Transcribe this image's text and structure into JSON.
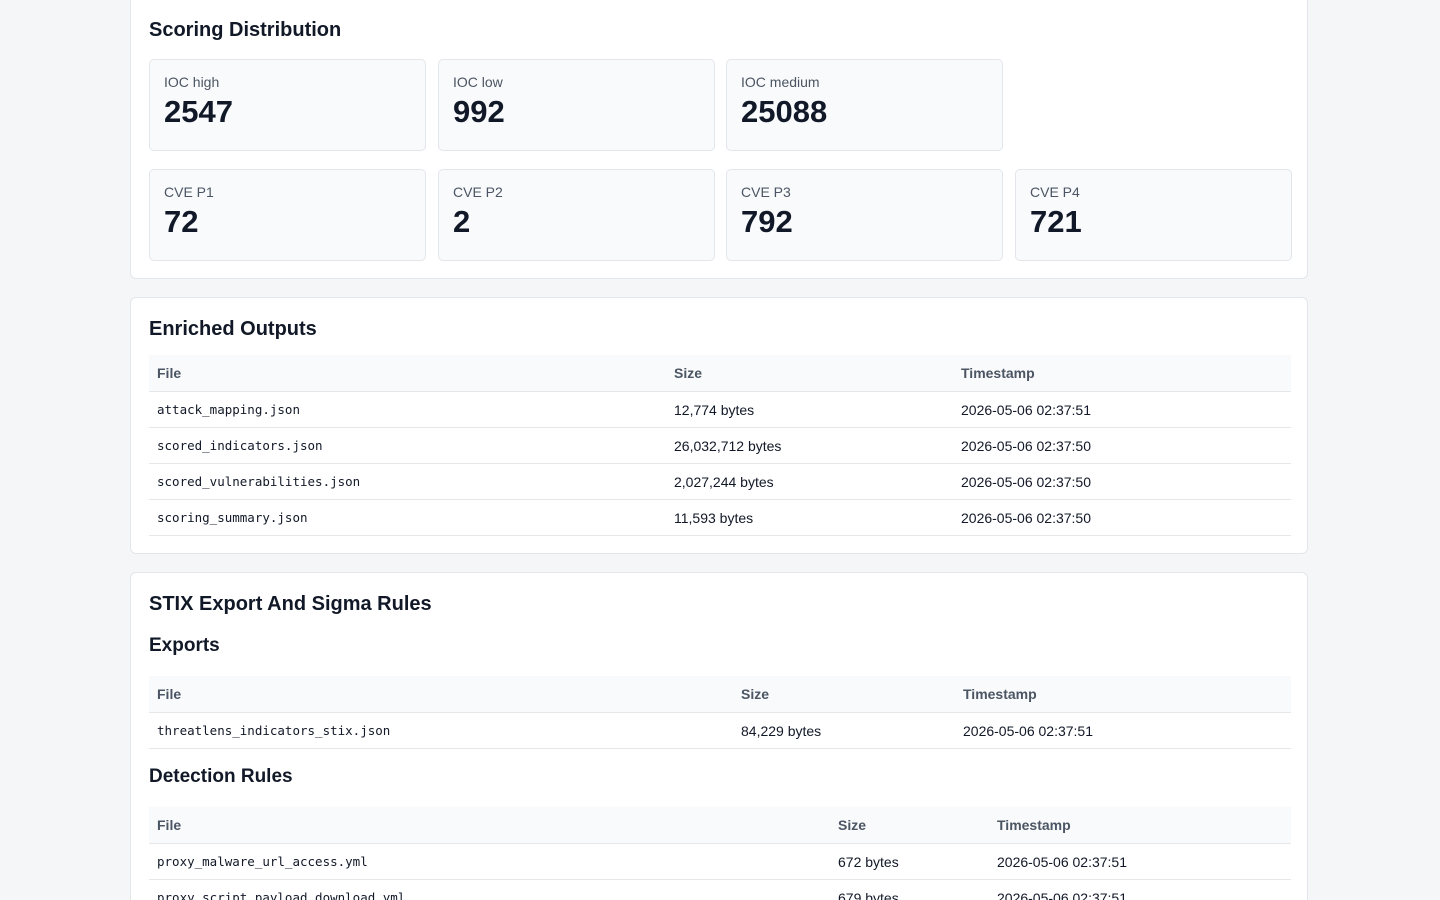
{
  "scoring": {
    "title": "Scoring Distribution",
    "ioc": [
      {
        "label": "IOC high",
        "value": "2547"
      },
      {
        "label": "IOC low",
        "value": "992"
      },
      {
        "label": "IOC medium",
        "value": "25088"
      }
    ],
    "cve": [
      {
        "label": "CVE P1",
        "value": "72"
      },
      {
        "label": "CVE P2",
        "value": "2"
      },
      {
        "label": "CVE P3",
        "value": "792"
      },
      {
        "label": "CVE P4",
        "value": "721"
      }
    ]
  },
  "enriched": {
    "title": "Enriched Outputs",
    "headers": {
      "file": "File",
      "size": "Size",
      "timestamp": "Timestamp"
    },
    "rows": [
      {
        "file": "attack_mapping.json",
        "size": "12,774 bytes",
        "timestamp": "2026-05-06 02:37:51"
      },
      {
        "file": "scored_indicators.json",
        "size": "26,032,712 bytes",
        "timestamp": "2026-05-06 02:37:50"
      },
      {
        "file": "scored_vulnerabilities.json",
        "size": "2,027,244 bytes",
        "timestamp": "2026-05-06 02:37:50"
      },
      {
        "file": "scoring_summary.json",
        "size": "11,593 bytes",
        "timestamp": "2026-05-06 02:37:50"
      }
    ]
  },
  "stix": {
    "title": "STIX Export And Sigma Rules",
    "exports": {
      "title": "Exports",
      "headers": {
        "file": "File",
        "size": "Size",
        "timestamp": "Timestamp"
      },
      "rows": [
        {
          "file": "threatlens_indicators_stix.json",
          "size": "84,229 bytes",
          "timestamp": "2026-05-06 02:37:51"
        }
      ]
    },
    "rules": {
      "title": "Detection Rules",
      "headers": {
        "file": "File",
        "size": "Size",
        "timestamp": "Timestamp"
      },
      "rows": [
        {
          "file": "proxy_malware_url_access.yml",
          "size": "672 bytes",
          "timestamp": "2026-05-06 02:37:51"
        },
        {
          "file": "proxy_script_payload_download.yml",
          "size": "679 bytes",
          "timestamp": "2026-05-06 02:37:51"
        }
      ]
    }
  }
}
